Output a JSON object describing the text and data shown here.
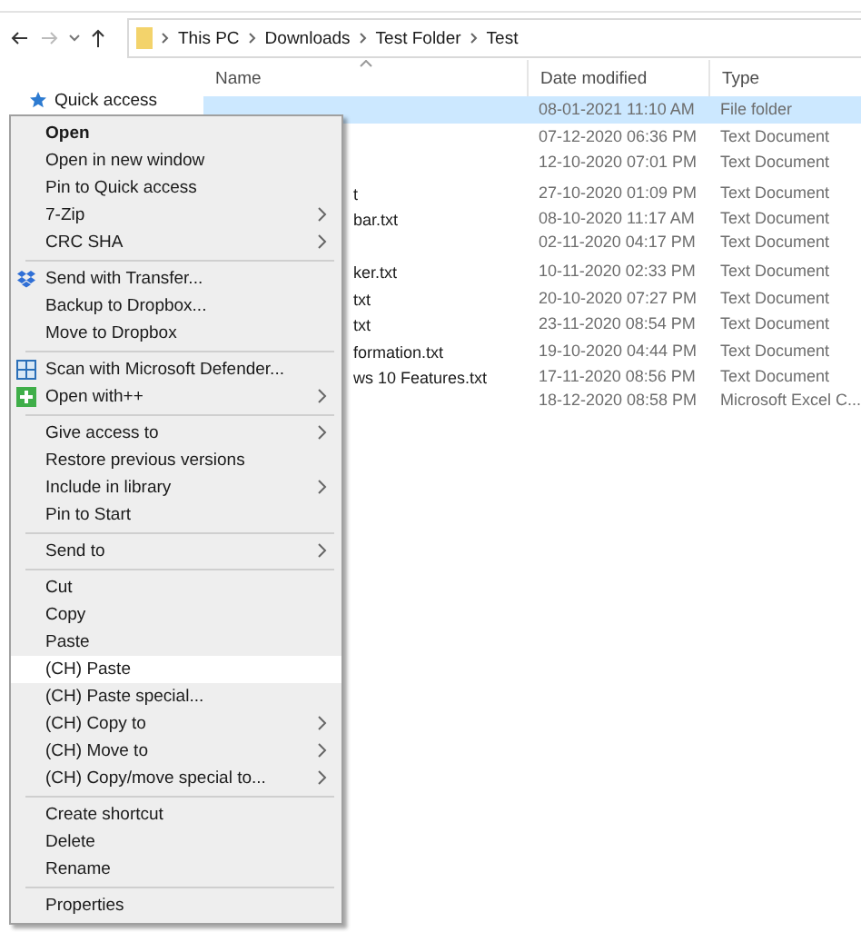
{
  "address_bar": {
    "path": [
      "This PC",
      "Downloads",
      "Test Folder",
      "Test"
    ]
  },
  "navigation_pane": {
    "items": [
      {
        "label": "Quick access"
      }
    ]
  },
  "file_list": {
    "columns": [
      "Name",
      "Date modified",
      "Type"
    ],
    "rows": [
      {
        "name": "",
        "date": "08-01-2021 11:10 AM",
        "type": "File folder",
        "selected": true
      },
      {
        "name": "",
        "date": "07-12-2020 06:36 PM",
        "type": "Text Document",
        "selected": false
      },
      {
        "name": "",
        "date": "12-10-2020 07:01 PM",
        "type": "Text Document",
        "selected": false
      },
      {
        "name": "t",
        "date": "27-10-2020 01:09 PM",
        "type": "Text Document",
        "selected": false
      },
      {
        "name": "bar.txt",
        "date": "08-10-2020 11:17 AM",
        "type": "Text Document",
        "selected": false
      },
      {
        "name": "",
        "date": "02-11-2020 04:17 PM",
        "type": "Text Document",
        "selected": false
      },
      {
        "name": "ker.txt",
        "date": "10-11-2020 02:33 PM",
        "type": "Text Document",
        "selected": false
      },
      {
        "name": "txt",
        "date": "20-10-2020 07:27 PM",
        "type": "Text Document",
        "selected": false
      },
      {
        "name": "txt",
        "date": "23-11-2020 08:54 PM",
        "type": "Text Document",
        "selected": false
      },
      {
        "name": "formation.txt",
        "date": "19-10-2020 04:44 PM",
        "type": "Text Document",
        "selected": false
      },
      {
        "name": "ws 10 Features.txt",
        "date": "17-11-2020 08:56 PM",
        "type": "Text Document",
        "selected": false
      },
      {
        "name": "",
        "date": "18-12-2020 08:58 PM",
        "type": "Microsoft Excel C...",
        "selected": false
      }
    ]
  },
  "context_menu": {
    "groups": [
      [
        {
          "label": "Open",
          "kind": "plain",
          "default": true,
          "submenu": false,
          "selected": false
        },
        {
          "label": "Open in new window",
          "kind": "plain",
          "default": false,
          "submenu": false,
          "selected": false
        },
        {
          "label": "Pin to Quick access",
          "kind": "plain",
          "default": false,
          "submenu": false,
          "selected": false
        },
        {
          "label": "7-Zip",
          "kind": "plain",
          "default": false,
          "submenu": true,
          "selected": false
        },
        {
          "label": "CRC SHA",
          "kind": "plain",
          "default": false,
          "submenu": true,
          "selected": false
        }
      ],
      [
        {
          "label": "Send with Transfer...",
          "kind": "dropbox",
          "default": false,
          "submenu": false,
          "selected": false
        },
        {
          "label": "Backup to Dropbox...",
          "kind": "plain",
          "default": false,
          "submenu": false,
          "selected": false
        },
        {
          "label": "Move to Dropbox",
          "kind": "plain",
          "default": false,
          "submenu": false,
          "selected": false
        }
      ],
      [
        {
          "label": "Scan with Microsoft Defender...",
          "kind": "defender",
          "default": false,
          "submenu": false,
          "selected": false
        },
        {
          "label": "Open with++",
          "kind": "openwith",
          "default": false,
          "submenu": true,
          "selected": false
        }
      ],
      [
        {
          "label": "Give access to",
          "kind": "plain",
          "default": false,
          "submenu": true,
          "selected": false
        },
        {
          "label": "Restore previous versions",
          "kind": "plain",
          "default": false,
          "submenu": false,
          "selected": false
        },
        {
          "label": "Include in library",
          "kind": "plain",
          "default": false,
          "submenu": true,
          "selected": false
        },
        {
          "label": "Pin to Start",
          "kind": "plain",
          "default": false,
          "submenu": false,
          "selected": false
        }
      ],
      [
        {
          "label": "Send to",
          "kind": "plain",
          "default": false,
          "submenu": true,
          "selected": false
        }
      ],
      [
        {
          "label": "Cut",
          "kind": "plain",
          "default": false,
          "submenu": false,
          "selected": false
        },
        {
          "label": "Copy",
          "kind": "plain",
          "default": false,
          "submenu": false,
          "selected": false
        },
        {
          "label": "Paste",
          "kind": "plain",
          "default": false,
          "submenu": false,
          "selected": false
        },
        {
          "label": "(CH) Paste",
          "kind": "plain",
          "default": false,
          "submenu": false,
          "selected": true
        },
        {
          "label": "(CH) Paste special...",
          "kind": "plain",
          "default": false,
          "submenu": false,
          "selected": false
        },
        {
          "label": "(CH) Copy to",
          "kind": "plain",
          "default": false,
          "submenu": true,
          "selected": false
        },
        {
          "label": "(CH) Move to",
          "kind": "plain",
          "default": false,
          "submenu": true,
          "selected": false
        },
        {
          "label": "(CH) Copy/move special to...",
          "kind": "plain",
          "default": false,
          "submenu": true,
          "selected": false
        }
      ],
      [
        {
          "label": "Create shortcut",
          "kind": "plain",
          "default": false,
          "submenu": false,
          "selected": false
        },
        {
          "label": "Delete",
          "kind": "plain",
          "default": false,
          "submenu": false,
          "selected": false
        },
        {
          "label": "Rename",
          "kind": "plain",
          "default": false,
          "submenu": false,
          "selected": false
        }
      ],
      [
        {
          "label": "Properties",
          "kind": "plain",
          "default": false,
          "submenu": false,
          "selected": false
        }
      ]
    ]
  }
}
